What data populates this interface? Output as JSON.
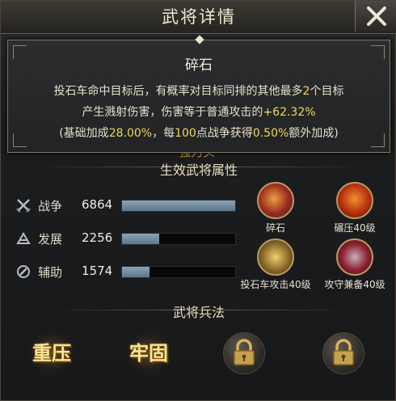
{
  "window": {
    "title": "武将详情"
  },
  "tooltip": {
    "skill_name": "碎石",
    "line1_prefix": "投石车命中目标后，有概率对目标同排的其他最多",
    "line1_num": "2",
    "line1_suffix": "个目标",
    "line2_prefix": "产生溅射伤害，伤害等于普通攻击的",
    "line2_num": "+62.32%",
    "line3_a": "(基础加成",
    "line3_b": "28.00%",
    "line3_c": "，每",
    "line3_d": "100",
    "line3_e": "点战争获得",
    "line3_f": "0.50%",
    "line3_g": "额外加成)",
    "obscured_text": "强力头"
  },
  "attributes": {
    "title": "生效武将属性",
    "rows": [
      {
        "label": "战争",
        "value": "6864",
        "fill": 1.0,
        "icon": "crossed-swords-icon"
      },
      {
        "label": "发展",
        "value": "2256",
        "fill": 0.33,
        "icon": "development-icon"
      },
      {
        "label": "辅助",
        "value": "1574",
        "fill": 0.24,
        "icon": "support-icon"
      }
    ]
  },
  "skills": [
    {
      "label": "碎石",
      "icon": "shattered-stone-icon"
    },
    {
      "label": "碾压40级",
      "icon": "crush-icon"
    },
    {
      "label": "投石车攻击40级",
      "icon": "catapult-attack-icon"
    },
    {
      "label": "攻守兼备40级",
      "icon": "offense-defense-icon"
    }
  ],
  "tactics": {
    "title": "武将兵法",
    "items": [
      {
        "label": "重压",
        "state": "unlocked"
      },
      {
        "label": "牢固",
        "state": "unlocked"
      },
      {
        "label": "",
        "state": "locked"
      },
      {
        "label": "",
        "state": "locked"
      }
    ]
  },
  "colors": {
    "highlight": "#f0d85a",
    "bar": "#7d97aa",
    "gold": "#b99a5c"
  }
}
